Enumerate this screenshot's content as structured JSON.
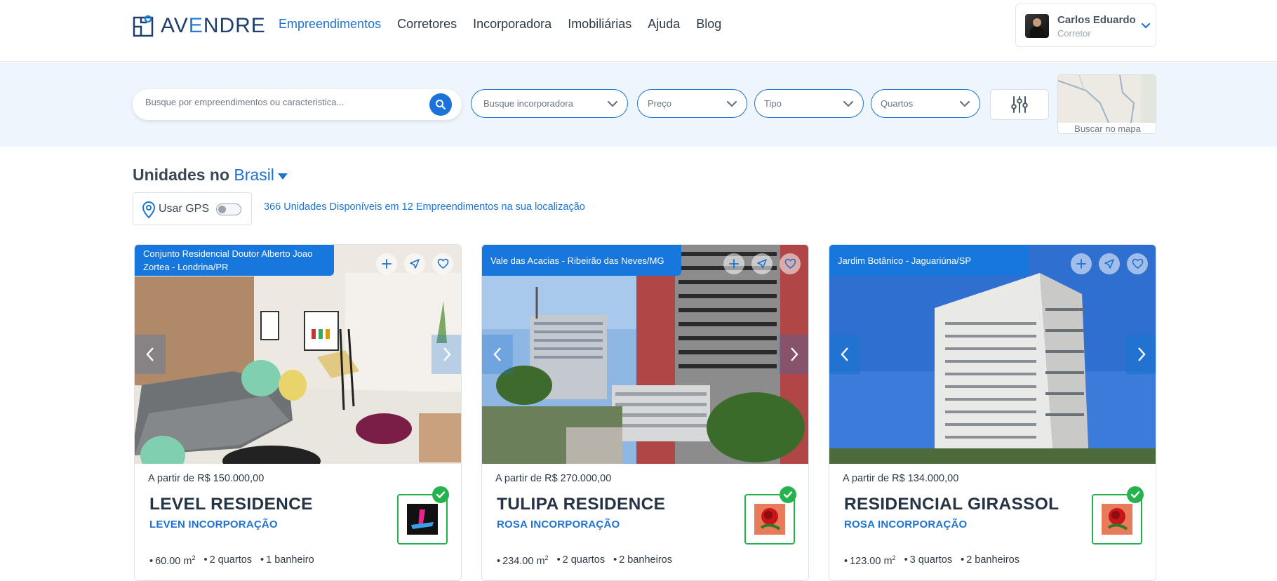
{
  "header": {
    "logo_text_start": "AV",
    "logo_text_accent": "E",
    "logo_text_end": "NDRE",
    "nav": [
      {
        "label": "Empreendimentos",
        "active": true
      },
      {
        "label": "Corretores",
        "active": false
      },
      {
        "label": "Incorporadora",
        "active": false
      },
      {
        "label": "Imobiliárias",
        "active": false
      },
      {
        "label": "Ajuda",
        "active": false
      },
      {
        "label": "Blog",
        "active": false
      }
    ],
    "user": {
      "name": "Carlos Eduardo",
      "role": "Corretor"
    }
  },
  "search": {
    "placeholder": "Busque por empreendimentos ou caracteristica...",
    "incorporadora": "Busque incorporadora",
    "preco": "Preço",
    "tipo": "Tipo",
    "quartos": "Quartos",
    "map_label": "Buscar no mapa"
  },
  "section": {
    "title_prefix": "Unidades no",
    "location": "Brasil",
    "gps_label": "Usar GPS",
    "units_info": "366 Unidades Disponíveis em 12 Empreendimentos na sua localização"
  },
  "cards": [
    {
      "location": "Conjunto Residencial Doutor Alberto Joao Zortea - Londrina/PR",
      "price": "A partir de R$ 150.000,00",
      "title": "LEVEL RESIDENCE",
      "builder": "LEVEN INCORPORAÇÃO",
      "area": "60.00 m",
      "quartos": "2 quartos",
      "banheiros": "1 banheiro"
    },
    {
      "location": "Vale das Acacias - Ribeirão das Neves/MG",
      "price": "A partir de R$ 270.000,00",
      "title": "TULIPA RESIDENCE",
      "builder": "ROSA INCORPORAÇÃO",
      "area": "234.00 m",
      "quartos": "2 quartos",
      "banheiros": "2 banheiros"
    },
    {
      "location": "Jardim Botânico - Jaguariúna/SP",
      "price": "A partir de R$ 134.000,00",
      "title": "RESIDENCIAL GIRASSOL",
      "builder": "ROSA INCORPORAÇÃO",
      "area": "123.00 m",
      "quartos": "3 quartos",
      "banheiros": "2 banheiros"
    }
  ],
  "area_unit_sup": "2",
  "colors": {
    "primary": "#1e73d2",
    "verified": "#24b34c",
    "strip": "#eef5fc"
  }
}
